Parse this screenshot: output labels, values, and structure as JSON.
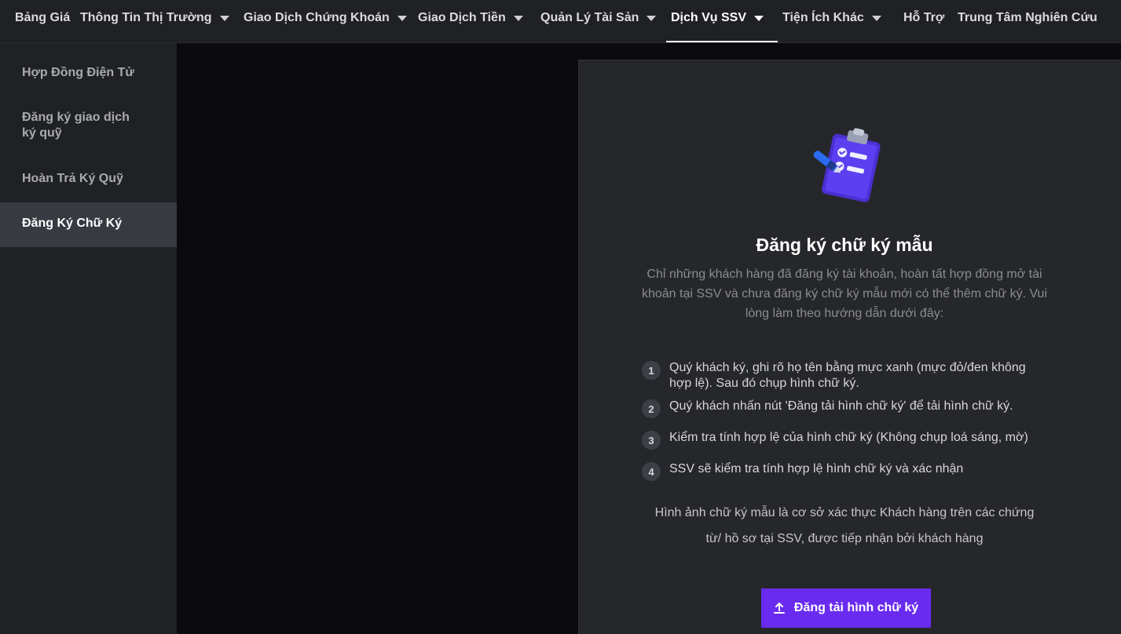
{
  "topnav": {
    "items": [
      {
        "label": "Bảng Giá",
        "has_dropdown": false
      },
      {
        "label": "Thông Tin Thị Trường",
        "has_dropdown": true
      },
      {
        "label": "Giao Dịch Chứng Khoán",
        "has_dropdown": true
      },
      {
        "label": "Giao Dịch Tiền",
        "has_dropdown": true
      },
      {
        "label": "Quản Lý Tài Sản",
        "has_dropdown": true
      },
      {
        "label": "Dịch Vụ SSV",
        "has_dropdown": true,
        "active": true
      },
      {
        "label": "Tiện Ích Khác",
        "has_dropdown": true
      },
      {
        "label": "Hỗ Trợ",
        "has_dropdown": false
      },
      {
        "label": "Trung Tâm Nghiên Cứu",
        "has_dropdown": false
      }
    ]
  },
  "sidebar": {
    "items": [
      {
        "label": "Hợp Đồng Điện Tử"
      },
      {
        "label": "Đăng ký giao dịch ký quỹ"
      },
      {
        "label": "Hoàn Trả Ký Quỹ"
      },
      {
        "label": "Đăng Ký Chữ Ký",
        "active": true
      }
    ]
  },
  "main": {
    "illustration_icon": "clipboard-checklist-icon",
    "title": "Đăng ký chữ ký mẫu",
    "description": "Chỉ những khách hàng đã đăng ký tài khoản, hoàn tất hợp đồng mở tài khoản tại SSV và chưa đăng ký chữ ký mẫu mới có thể thêm chữ ký. Vui lòng làm theo hướng dẫn dưới đây:",
    "steps": [
      {
        "num": "1",
        "text": "Quý khách ký, ghi rõ họ tên bằng mực xanh (mực đỏ/đen không hợp lệ). Sau đó chụp hình chữ ký."
      },
      {
        "num": "2",
        "text": "Quý khách nhấn nút 'Đăng tải hình chữ ký' để tải hình chữ ký."
      },
      {
        "num": "3",
        "text": "Kiểm tra tính hợp lệ của hình chữ ký (Không chụp loá sáng, mờ)"
      },
      {
        "num": "4",
        "text": "SSV sẽ kiểm tra tính hợp lệ hình chữ ký và xác nhận"
      }
    ],
    "note": "Hình ảnh chữ ký mẫu là cơ sở xác thực Khách hàng trên các chứng từ/ hồ sơ tại SSV, được tiếp nhận bởi khách hàng",
    "upload_button": {
      "label": "Đăng tải hình chữ ký",
      "icon": "upload-icon"
    }
  },
  "colors": {
    "background": "#0b0b0d",
    "nav_background": "#202125",
    "panel_background": "#26272b",
    "sidebar_active": "#383a42",
    "accent": "#6a2bf0"
  }
}
